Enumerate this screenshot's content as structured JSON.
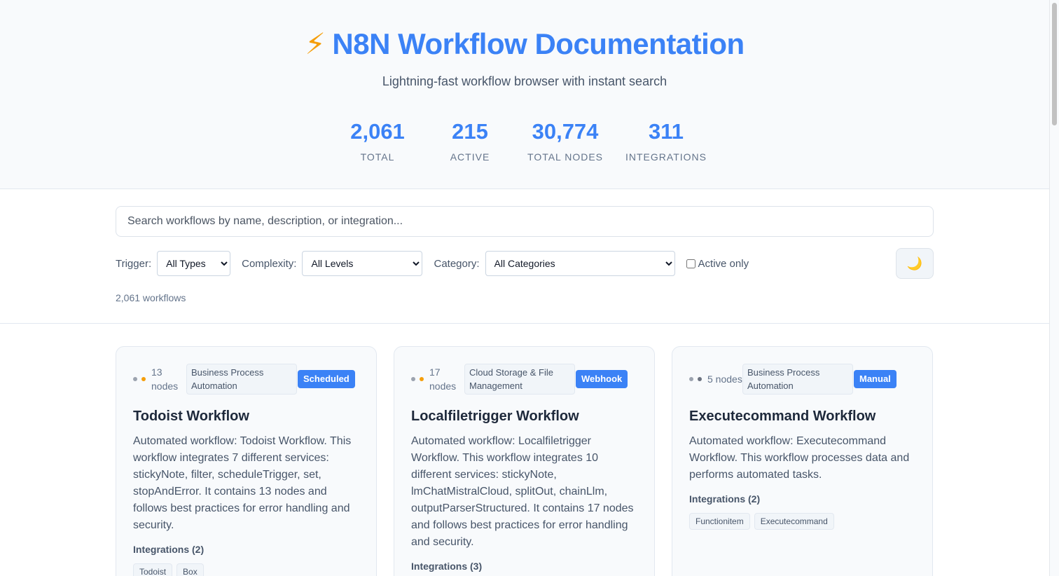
{
  "header": {
    "title": "N8N Workflow Documentation",
    "subtitle": "Lightning-fast workflow browser with instant search",
    "stats": [
      {
        "value": "2,061",
        "label": "TOTAL"
      },
      {
        "value": "215",
        "label": "ACTIVE"
      },
      {
        "value": "30,774",
        "label": "TOTAL NODES"
      },
      {
        "value": "311",
        "label": "INTEGRATIONS"
      }
    ]
  },
  "controls": {
    "search_placeholder": "Search workflows by name, description, or integration...",
    "trigger_label": "Trigger:",
    "trigger_value": "All Types",
    "complexity_label": "Complexity:",
    "complexity_value": "All Levels",
    "category_label": "Category:",
    "category_value": "All Categories",
    "active_only_label": "Active only",
    "theme_icon": "🌙",
    "count": "2,061 workflows"
  },
  "cards": [
    {
      "nodes": "13 nodes",
      "category": "Business Process Automation",
      "trigger": "Scheduled",
      "title": "Todoist Workflow",
      "description": "Automated workflow: Todoist Workflow. This workflow integrates 7 different services: stickyNote, filter, scheduleTrigger, set, stopAndError. It contains 13 nodes and follows best practices for error handling and security.",
      "integrations_title": "Integrations (2)",
      "integrations": [
        "Todoist",
        "Box"
      ]
    },
    {
      "nodes": "17 nodes",
      "category": "Cloud Storage & File Management",
      "trigger": "Webhook",
      "title": "Localfiletrigger Workflow",
      "description": "Automated workflow: Localfiletrigger Workflow. This workflow integrates 10 different services: stickyNote, lmChatMistralCloud, splitOut, chainLlm, outputParserStructured. It contains 17 nodes and follows best practices for error handling and security.",
      "integrations_title": "Integrations (3)",
      "integrations": []
    },
    {
      "nodes": "5 nodes",
      "category": "Business Process Automation",
      "trigger": "Manual",
      "title": "Executecommand Workflow",
      "description": "Automated workflow: Executecommand Workflow. This workflow processes data and performs automated tasks.",
      "integrations_title": "Integrations (2)",
      "integrations": [
        "Functionitem",
        "Executecommand"
      ]
    }
  ]
}
